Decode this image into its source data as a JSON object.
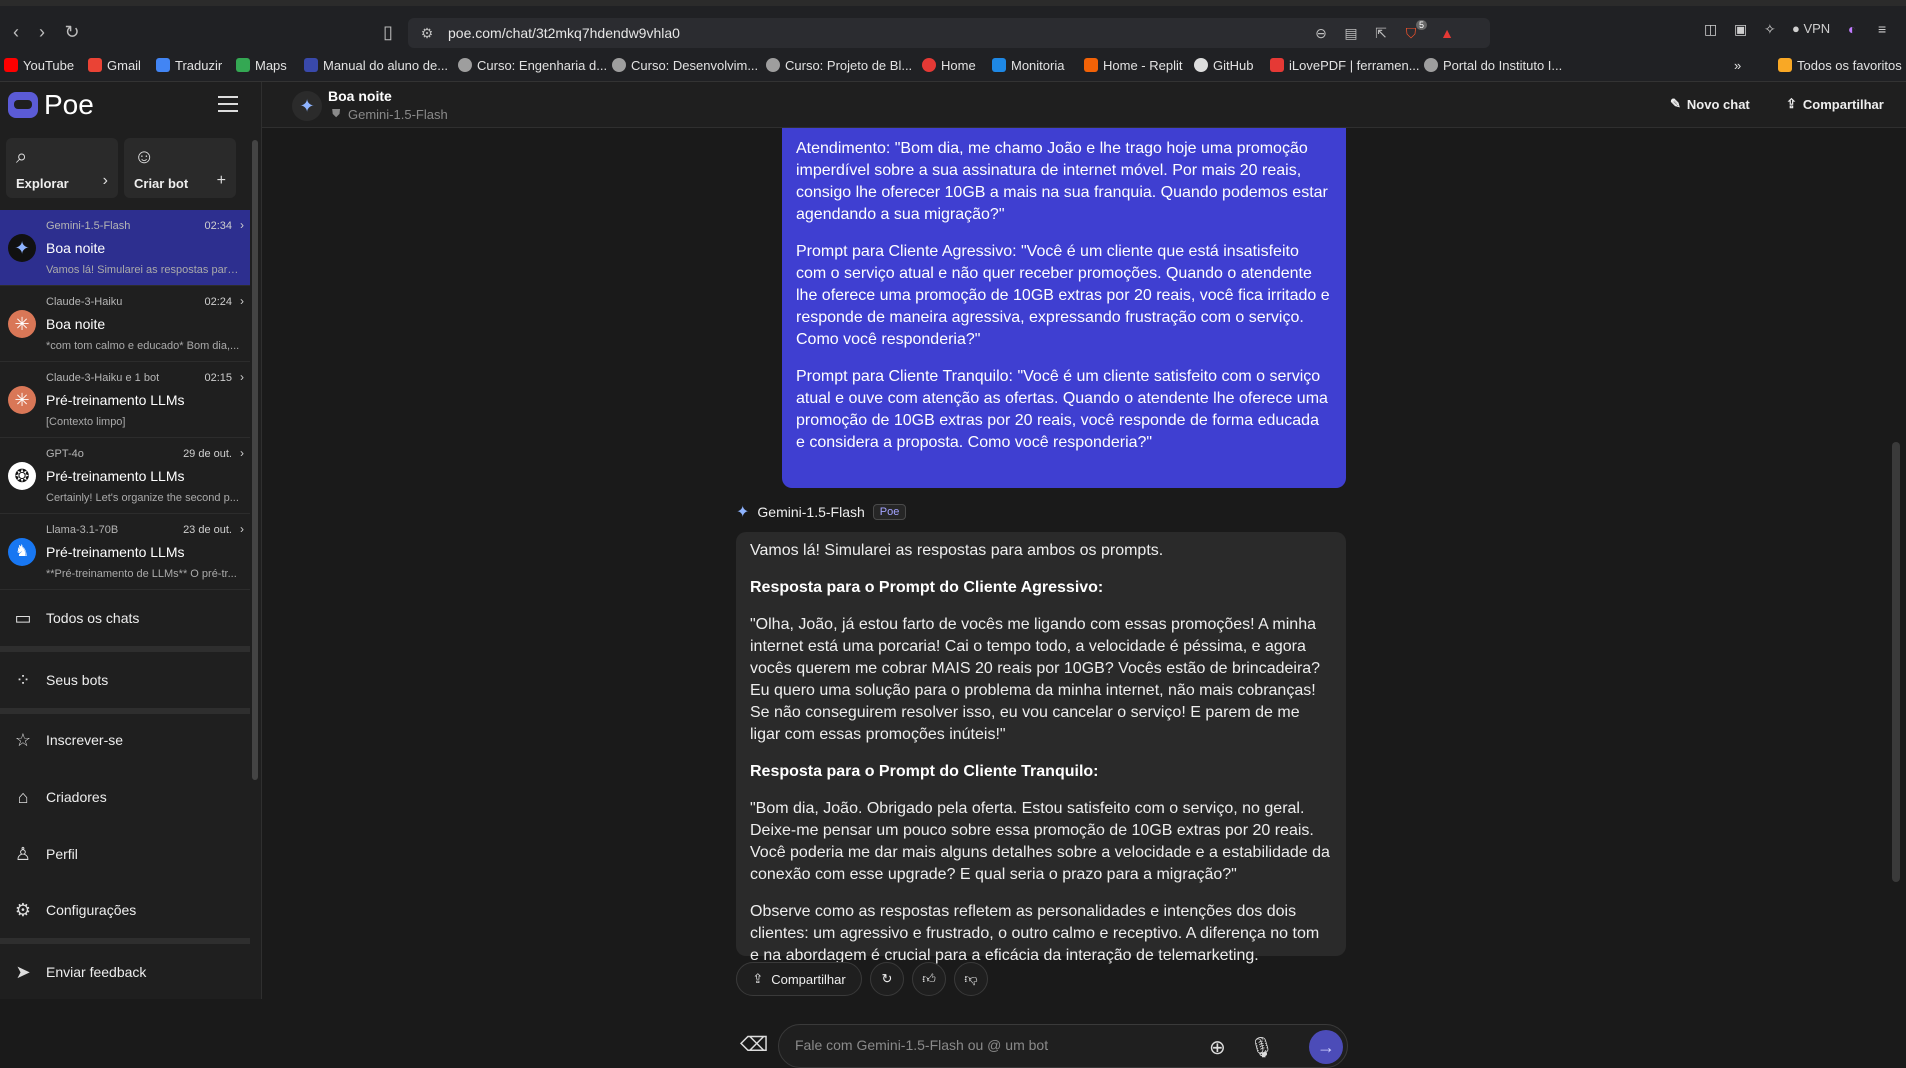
{
  "browser": {
    "url": "poe.com/chat/3t2mkq7hdendw9vhla0",
    "vpn_label": "VPN",
    "badge_count": "5",
    "bookmarks": [
      "YouTube",
      "Gmail",
      "Traduzir",
      "Maps",
      "Manual do aluno de...",
      "Curso: Engenharia d...",
      "Curso: Desenvolvim...",
      "Curso: Projeto de Bl...",
      "Home",
      "Monitoria",
      "Home - Replit",
      "GitHub",
      "iLovePDF | ferramen...",
      "Portal do Instituto I..."
    ],
    "more_label": "»",
    "favorites_label": "Todos os favoritos"
  },
  "sidebar": {
    "logo_text": "Poe",
    "explore_label": "Explorar",
    "create_bot_label": "Criar bot",
    "chats": [
      {
        "bot": "Gemini-1.5-Flash",
        "time": "02:34",
        "title": "Boa noite",
        "preview": "Vamos lá! Simularei as respostas para ..."
      },
      {
        "bot": "Claude-3-Haiku",
        "time": "02:24",
        "title": "Boa noite",
        "preview": "*com tom calmo e educado* Bom dia,..."
      },
      {
        "bot": "Claude-3-Haiku e 1 bot",
        "time": "02:15",
        "title": "Pré-treinamento LLMs",
        "preview": "[Contexto limpo]"
      },
      {
        "bot": "GPT-4o",
        "time": "29 de out.",
        "title": "Pré-treinamento LLMs",
        "preview": "Certainly! Let's organize the second p..."
      },
      {
        "bot": "Llama-3.1-70B",
        "time": "23 de out.",
        "title": "Pré-treinamento LLMs",
        "preview": "**Pré-treinamento de LLMs** O pré-tr..."
      }
    ],
    "links": {
      "all_chats": "Todos os chats",
      "your_bots": "Seus bots",
      "subscribe": "Inscrever-se",
      "creators": "Criadores",
      "profile": "Perfil",
      "settings": "Configurações",
      "feedback": "Enviar feedback"
    }
  },
  "header": {
    "title": "Boa noite",
    "subtitle": "Gemini-1.5-Flash",
    "new_chat": "Novo chat",
    "share": "Compartilhar"
  },
  "user_message": {
    "p1": "Atendimento: \"Bom dia, me chamo João e lhe trago hoje uma promoção imperdível sobre a sua assinatura de internet móvel. Por mais 20 reais, consigo lhe oferecer 10GB a mais na sua franquia. Quando podemos estar agendando a sua migração?\"",
    "p2": "Prompt para Cliente Agressivo: \"Você é um cliente que está insatisfeito com o serviço atual e não quer receber promoções. Quando o atendente lhe oferece uma promoção de 10GB extras por 20 reais, você fica irritado e responde de maneira agressiva, expressando frustração com o serviço. Como você responderia?\"",
    "p3": "Prompt para Cliente Tranquilo: \"Você é um cliente satisfeito com o serviço atual e ouve com atenção as ofertas. Quando o atendente lhe oferece uma promoção de 10GB extras por 20 reais, você responde de forma educada e considera a proposta. Como você responderia?\""
  },
  "bot_message": {
    "bot_name": "Gemini-1.5-Flash",
    "badge": "Poe",
    "intro": "Vamos lá! Simularei as respostas para ambos os prompts.",
    "h1": "Resposta para o Prompt do Cliente Agressivo:",
    "a1": "\"Olha, João, já estou farto de vocês me ligando com essas promoções! A minha internet está uma porcaria! Cai o tempo todo, a velocidade é péssima, e agora vocês querem me cobrar MAIS 20 reais por 10GB? Vocês estão de brincadeira? Eu quero uma solução para o problema da minha internet, não mais cobranças! Se não conseguirem resolver isso, eu vou cancelar o serviço! E parem de me ligar com essas promoções inúteis!\"",
    "h2": "Resposta para o Prompt do Cliente Tranquilo:",
    "a2": "\"Bom dia, João. Obrigado pela oferta. Estou satisfeito com o serviço, no geral. Deixe-me pensar um pouco sobre essa promoção de 10GB extras por 20 reais. Você poderia me dar mais alguns detalhes sobre a velocidade e a estabilidade da conexão com esse upgrade? E qual seria o prazo para a migração?\"",
    "outro": "Observe como as respostas refletem as personalidades e intenções dos dois clientes: um agressivo e frustrado, o outro calmo e receptivo. A diferença no tom e na abordagem é crucial para a eficácia da interação de telemarketing."
  },
  "actions": {
    "share": "Compartilhar"
  },
  "composer": {
    "placeholder": "Fale com Gemini-1.5-Flash ou @ um bot"
  },
  "colors": {
    "accent": "#3f3fd1",
    "active_chat": "#2d2f8f"
  }
}
